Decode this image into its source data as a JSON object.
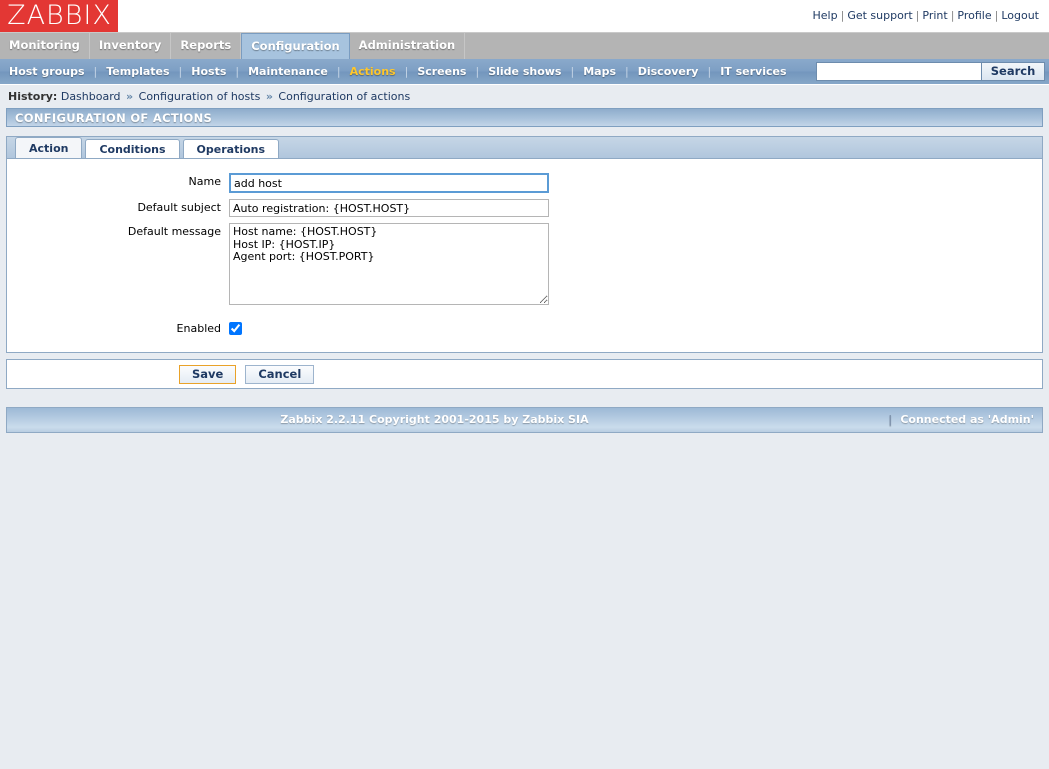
{
  "brand": {
    "logo_text": "ZABBIX",
    "logo_color": "#e33734"
  },
  "toplinks": [
    {
      "label": "Help"
    },
    {
      "label": "Get support"
    },
    {
      "label": "Print"
    },
    {
      "label": "Profile"
    },
    {
      "label": "Logout"
    }
  ],
  "mainmenu": [
    {
      "label": "Monitoring",
      "active": false
    },
    {
      "label": "Inventory",
      "active": false
    },
    {
      "label": "Reports",
      "active": false
    },
    {
      "label": "Configuration",
      "active": true
    },
    {
      "label": "Administration",
      "active": false
    }
  ],
  "submenu": [
    {
      "label": "Host groups",
      "selected": false
    },
    {
      "label": "Templates",
      "selected": false
    },
    {
      "label": "Hosts",
      "selected": false
    },
    {
      "label": "Maintenance",
      "selected": false
    },
    {
      "label": "Actions",
      "selected": true
    },
    {
      "label": "Screens",
      "selected": false
    },
    {
      "label": "Slide shows",
      "selected": false
    },
    {
      "label": "Maps",
      "selected": false
    },
    {
      "label": "Discovery",
      "selected": false
    },
    {
      "label": "IT services",
      "selected": false
    }
  ],
  "search": {
    "value": "",
    "placeholder": "",
    "button_label": "Search"
  },
  "history": {
    "label": "History:",
    "items": [
      {
        "label": "Dashboard"
      },
      {
        "label": "Configuration of hosts"
      },
      {
        "label": "Configuration of actions"
      }
    ],
    "separator": "»"
  },
  "page": {
    "title": "CONFIGURATION OF ACTIONS"
  },
  "tabs": [
    {
      "label": "Action",
      "active": true
    },
    {
      "label": "Conditions",
      "active": false
    },
    {
      "label": "Operations",
      "active": false
    }
  ],
  "form": {
    "name": {
      "label": "Name",
      "value": "add host",
      "focused": true
    },
    "default_subject": {
      "label": "Default subject",
      "value": "Auto registration: {HOST.HOST}"
    },
    "default_message": {
      "label": "Default message",
      "value": "Host name: {HOST.HOST}\nHost IP: {HOST.IP}\nAgent port: {HOST.PORT}"
    },
    "enabled": {
      "label": "Enabled",
      "checked": true
    }
  },
  "buttons": {
    "save": "Save",
    "cancel": "Cancel"
  },
  "footer": {
    "copyright": "Zabbix 2.2.11 Copyright 2001-2015 by Zabbix SIA",
    "connected": "Connected as 'Admin'",
    "divider": "|"
  }
}
